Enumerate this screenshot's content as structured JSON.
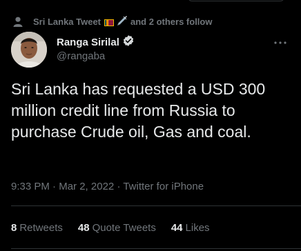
{
  "social_context": {
    "name": "Sri Lanka Tweet",
    "suffix": "and 2 others follow",
    "icons": [
      "person-icon",
      "sri-lanka-flag-icon",
      "syringe-icon"
    ]
  },
  "author": {
    "display_name": "Ranga Sirilal",
    "handle": "@rangaba",
    "verified": true
  },
  "tweet": {
    "text": "Sri Lanka has requested a USD 300 million credit line from Russia to purchase Crude oil, Gas and coal."
  },
  "meta": {
    "time": "9:33 PM",
    "date": "Mar 2, 2022",
    "source": "Twitter for iPhone",
    "separator": "·"
  },
  "stats": {
    "retweets": {
      "count": "8",
      "label": "Retweets"
    },
    "quotes": {
      "count": "48",
      "label": "Quote Tweets"
    },
    "likes": {
      "count": "44",
      "label": "Likes"
    }
  },
  "colors": {
    "background": "#000000",
    "primary_text": "#e7e9ea",
    "secondary_text": "#71767b",
    "divider": "#2f3336",
    "verified": "#d6d9db"
  }
}
